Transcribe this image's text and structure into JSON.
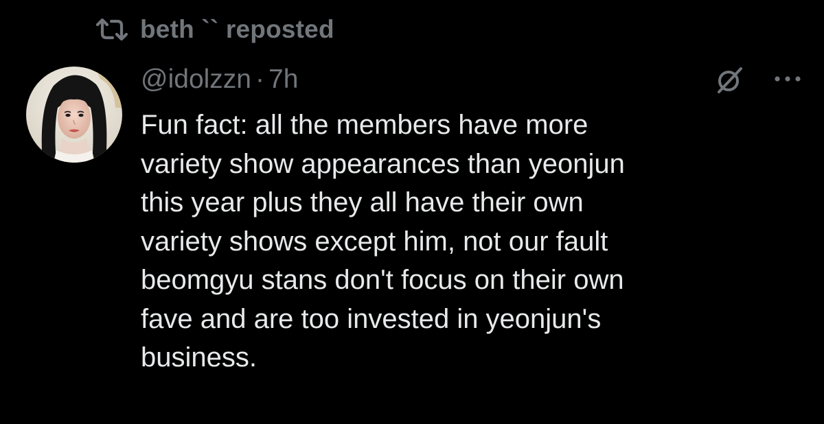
{
  "repost": {
    "icon": "repost-icon",
    "label": "beth `` reposted"
  },
  "post": {
    "avatar_icon": "user-avatar",
    "handle": "@idolzzn",
    "separator": "·",
    "time": "7h",
    "grok_icon": "grok-icon",
    "more_icon": "more-options-icon",
    "text_lines": [
      "Fun fact: all the members have more",
      "variety show appearances than yeonjun",
      "this year plus they all have their own",
      "variety shows except him, not our fault",
      "beomgyu stans don't focus on their own",
      "fave and are too invested in yeonjun's",
      "business."
    ]
  },
  "colors": {
    "background": "#000000",
    "primary_text": "#e7e9ea",
    "secondary_text": "#71767b"
  }
}
